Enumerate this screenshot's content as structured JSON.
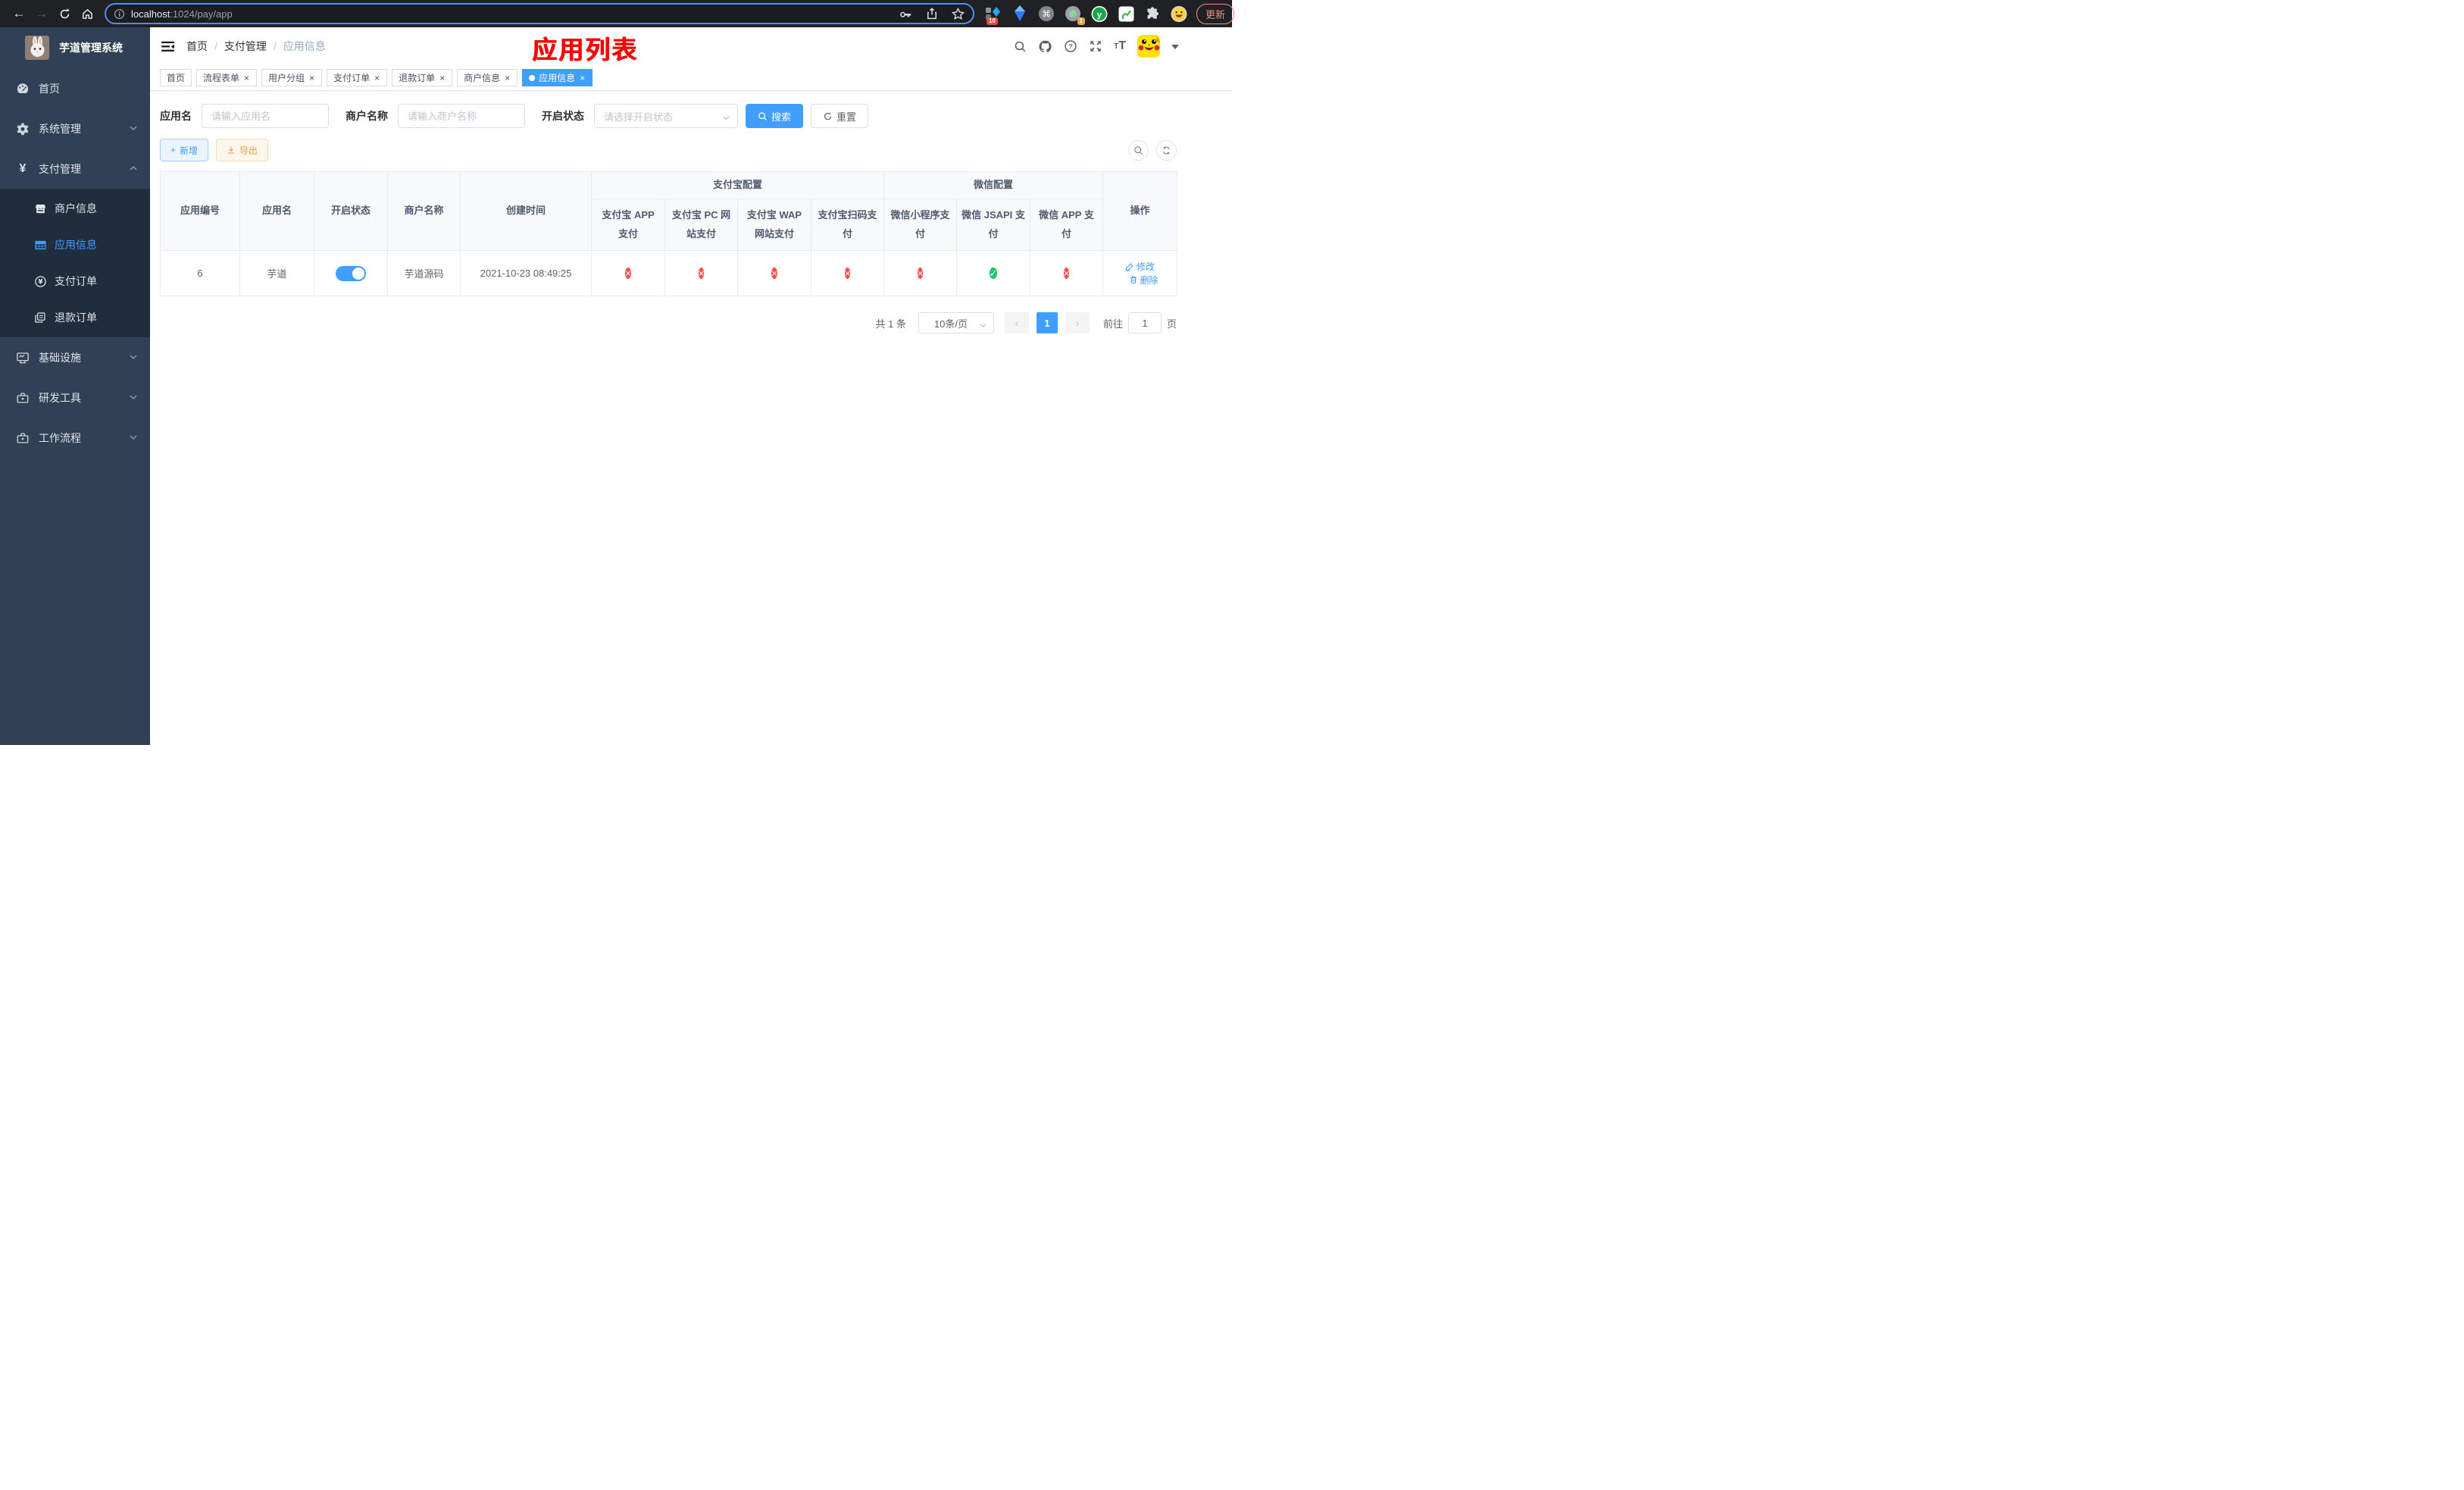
{
  "browser": {
    "url": {
      "host": "localhost",
      "rest": ":1024/pay/app"
    },
    "update_label": "更新",
    "ext_badge_blue_diamond": "10",
    "ext_badge_gray_circle": "1",
    "ext_green_letter": "y"
  },
  "sidebar": {
    "title": "芋道管理系统",
    "menu": [
      {
        "label": "首页",
        "icon": "dashboard-icon"
      },
      {
        "label": "系统管理",
        "icon": "gear-icon",
        "state": "collapsed"
      },
      {
        "label": "支付管理",
        "icon": "yen-icon",
        "state": "expanded"
      }
    ],
    "submenu": [
      {
        "label": "商户信息",
        "icon": "store-icon",
        "active": false
      },
      {
        "label": "应用信息",
        "icon": "grid-icon",
        "active": true
      },
      {
        "label": "支付订单",
        "icon": "coin-icon",
        "active": false
      },
      {
        "label": "退款订单",
        "icon": "document-icon",
        "active": false
      }
    ],
    "menu_lower": [
      {
        "label": "基础设施",
        "icon": "monitor-icon",
        "state": "collapsed"
      },
      {
        "label": "研发工具",
        "icon": "toolbox-icon",
        "state": "collapsed"
      },
      {
        "label": "工作流程",
        "icon": "toolbox-icon",
        "state": "collapsed"
      }
    ],
    "yen_glyph": "¥"
  },
  "header": {
    "breadcrumb": [
      "首页",
      "支付管理",
      "应用信息"
    ],
    "separator": "/",
    "annotation": "应用列表"
  },
  "tabs": [
    {
      "label": "首页",
      "closable": false,
      "active": false
    },
    {
      "label": "流程表单",
      "closable": true,
      "active": false
    },
    {
      "label": "用户分组",
      "closable": true,
      "active": false
    },
    {
      "label": "支付订单",
      "closable": true,
      "active": false
    },
    {
      "label": "退款订单",
      "closable": true,
      "active": false
    },
    {
      "label": "商户信息",
      "closable": true,
      "active": false
    },
    {
      "label": "应用信息",
      "closable": true,
      "active": true
    }
  ],
  "close_glyph": "×",
  "filters": {
    "app_name_label": "应用名",
    "app_name_placeholder": "请输入应用名",
    "merchant_label": "商户名称",
    "merchant_placeholder": "请输入商户名称",
    "status_label": "开启状态",
    "status_placeholder": "请选择开启状态",
    "search_label": "搜索",
    "reset_label": "重置"
  },
  "toolbar": {
    "add_label": "新增",
    "export_label": "导出",
    "plus_glyph": "+"
  },
  "table": {
    "group_headers": {
      "alipay": "支付宝配置",
      "wechat": "微信配置"
    },
    "columns": [
      "应用编号",
      "应用名",
      "开启状态",
      "商户名称",
      "创建时间",
      "支付宝 APP 支付",
      "支付宝 PC 网站支付",
      "支付宝 WAP 网站支付",
      "支付宝扫码支付",
      "微信小程序支付",
      "微信 JSAPI 支付",
      "微信 APP 支付",
      "操作"
    ],
    "row": {
      "id": "6",
      "name": "芋道",
      "enabled": true,
      "merchant": "芋道源码",
      "created": "2021-10-23 08:49:25",
      "statuses": [
        "no",
        "no",
        "no",
        "no",
        "no",
        "yes",
        "no"
      ],
      "edit_label": "修改",
      "delete_label": "删除"
    }
  },
  "pagination": {
    "total": "共 1 条",
    "page_size": "10条/页",
    "prev_glyph": "‹",
    "next_glyph": "›",
    "current_page": "1",
    "goto_label": "前往",
    "goto_value": "1",
    "page_unit": "页"
  },
  "colors": {
    "accent": "#409eff",
    "danger": "#f3514b",
    "success": "#1ec76a",
    "warning": "#e6a23c",
    "annotation": "#ff0000",
    "sidebar_bg": "#304156",
    "submenu_bg": "#1f2d3d"
  }
}
